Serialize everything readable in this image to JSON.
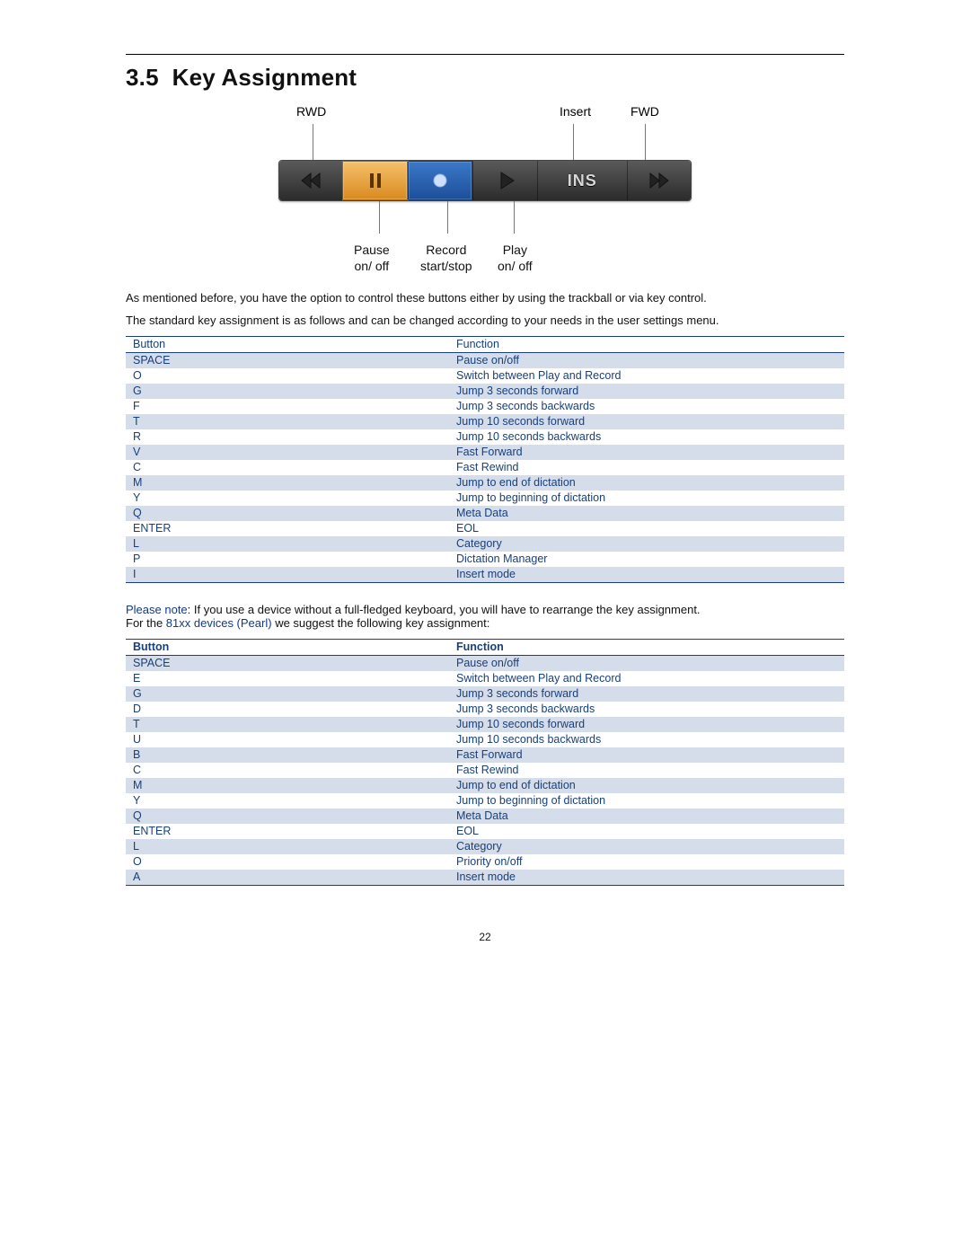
{
  "section_number": "3.5",
  "section_title": "Key Assignment",
  "figure": {
    "top_labels": {
      "rwd": "RWD",
      "insert": "Insert",
      "fwd": "FWD"
    },
    "ins_button": "INS",
    "bottom_labels": {
      "pause": "Pause\non/ off",
      "record": "Record\nstart/stop",
      "play": "Play\non/ off"
    }
  },
  "para1": "As mentioned before, you have the option to control these buttons either by using the trackball or via key control.",
  "para2": "The standard key assignment is as follows and can be changed according to your needs in the user settings menu.",
  "table1": {
    "headers": [
      "Button",
      "Function"
    ],
    "rows": [
      [
        "SPACE",
        "Pause on/off"
      ],
      [
        "O",
        "Switch between Play and Record"
      ],
      [
        "G",
        "Jump 3 seconds forward"
      ],
      [
        "F",
        "Jump 3 seconds backwards"
      ],
      [
        "T",
        "Jump 10 seconds forward"
      ],
      [
        "R",
        "Jump 10 seconds backwards"
      ],
      [
        "V",
        "Fast Forward"
      ],
      [
        "C",
        "Fast Rewind"
      ],
      [
        "M",
        "Jump to end of dictation"
      ],
      [
        "Y",
        "Jump to beginning of dictation"
      ],
      [
        "Q",
        "Meta Data"
      ],
      [
        "ENTER",
        "EOL"
      ],
      [
        "L",
        "Category"
      ],
      [
        "P",
        "Dictation Manager"
      ],
      [
        "I",
        "Insert mode"
      ]
    ],
    "stripes": [
      "a",
      "b",
      "a",
      "b",
      "a",
      "b",
      "a",
      "b",
      "a",
      "b",
      "a",
      "b",
      "a",
      "b",
      "a"
    ]
  },
  "note_prefix": "Please note",
  "note_rest": ": If you use a device without a full-fledged keyboard, you will have to rearrange the key assignment.",
  "note2_pre": "For the ",
  "note2_blue": "81xx devices (Pearl)",
  "note2_post": " we suggest the following key assignment:",
  "table2": {
    "headers": [
      "Button",
      "Function"
    ],
    "rows": [
      [
        "SPACE",
        "Pause on/off"
      ],
      [
        "E",
        "Switch between Play and Record"
      ],
      [
        "G",
        "Jump 3 seconds forward"
      ],
      [
        "D",
        "Jump 3 seconds backwards"
      ],
      [
        "T",
        "Jump 10 seconds forward"
      ],
      [
        "U",
        "Jump 10 seconds backwards"
      ],
      [
        "B",
        "Fast Forward"
      ],
      [
        "C",
        "Fast Rewind"
      ],
      [
        "M",
        "Jump to end of dictation"
      ],
      [
        "Y",
        "Jump to beginning of dictation"
      ],
      [
        "Q",
        "Meta Data"
      ],
      [
        "ENTER",
        "EOL"
      ],
      [
        "L",
        "Category"
      ],
      [
        "O",
        "Priority on/off"
      ],
      [
        "A",
        "Insert mode"
      ]
    ],
    "stripes": [
      "a",
      "b",
      "a",
      "b",
      "a",
      "b",
      "a",
      "b",
      "a",
      "b",
      "a",
      "b",
      "a",
      "b",
      "a"
    ]
  },
  "page_number": "22"
}
